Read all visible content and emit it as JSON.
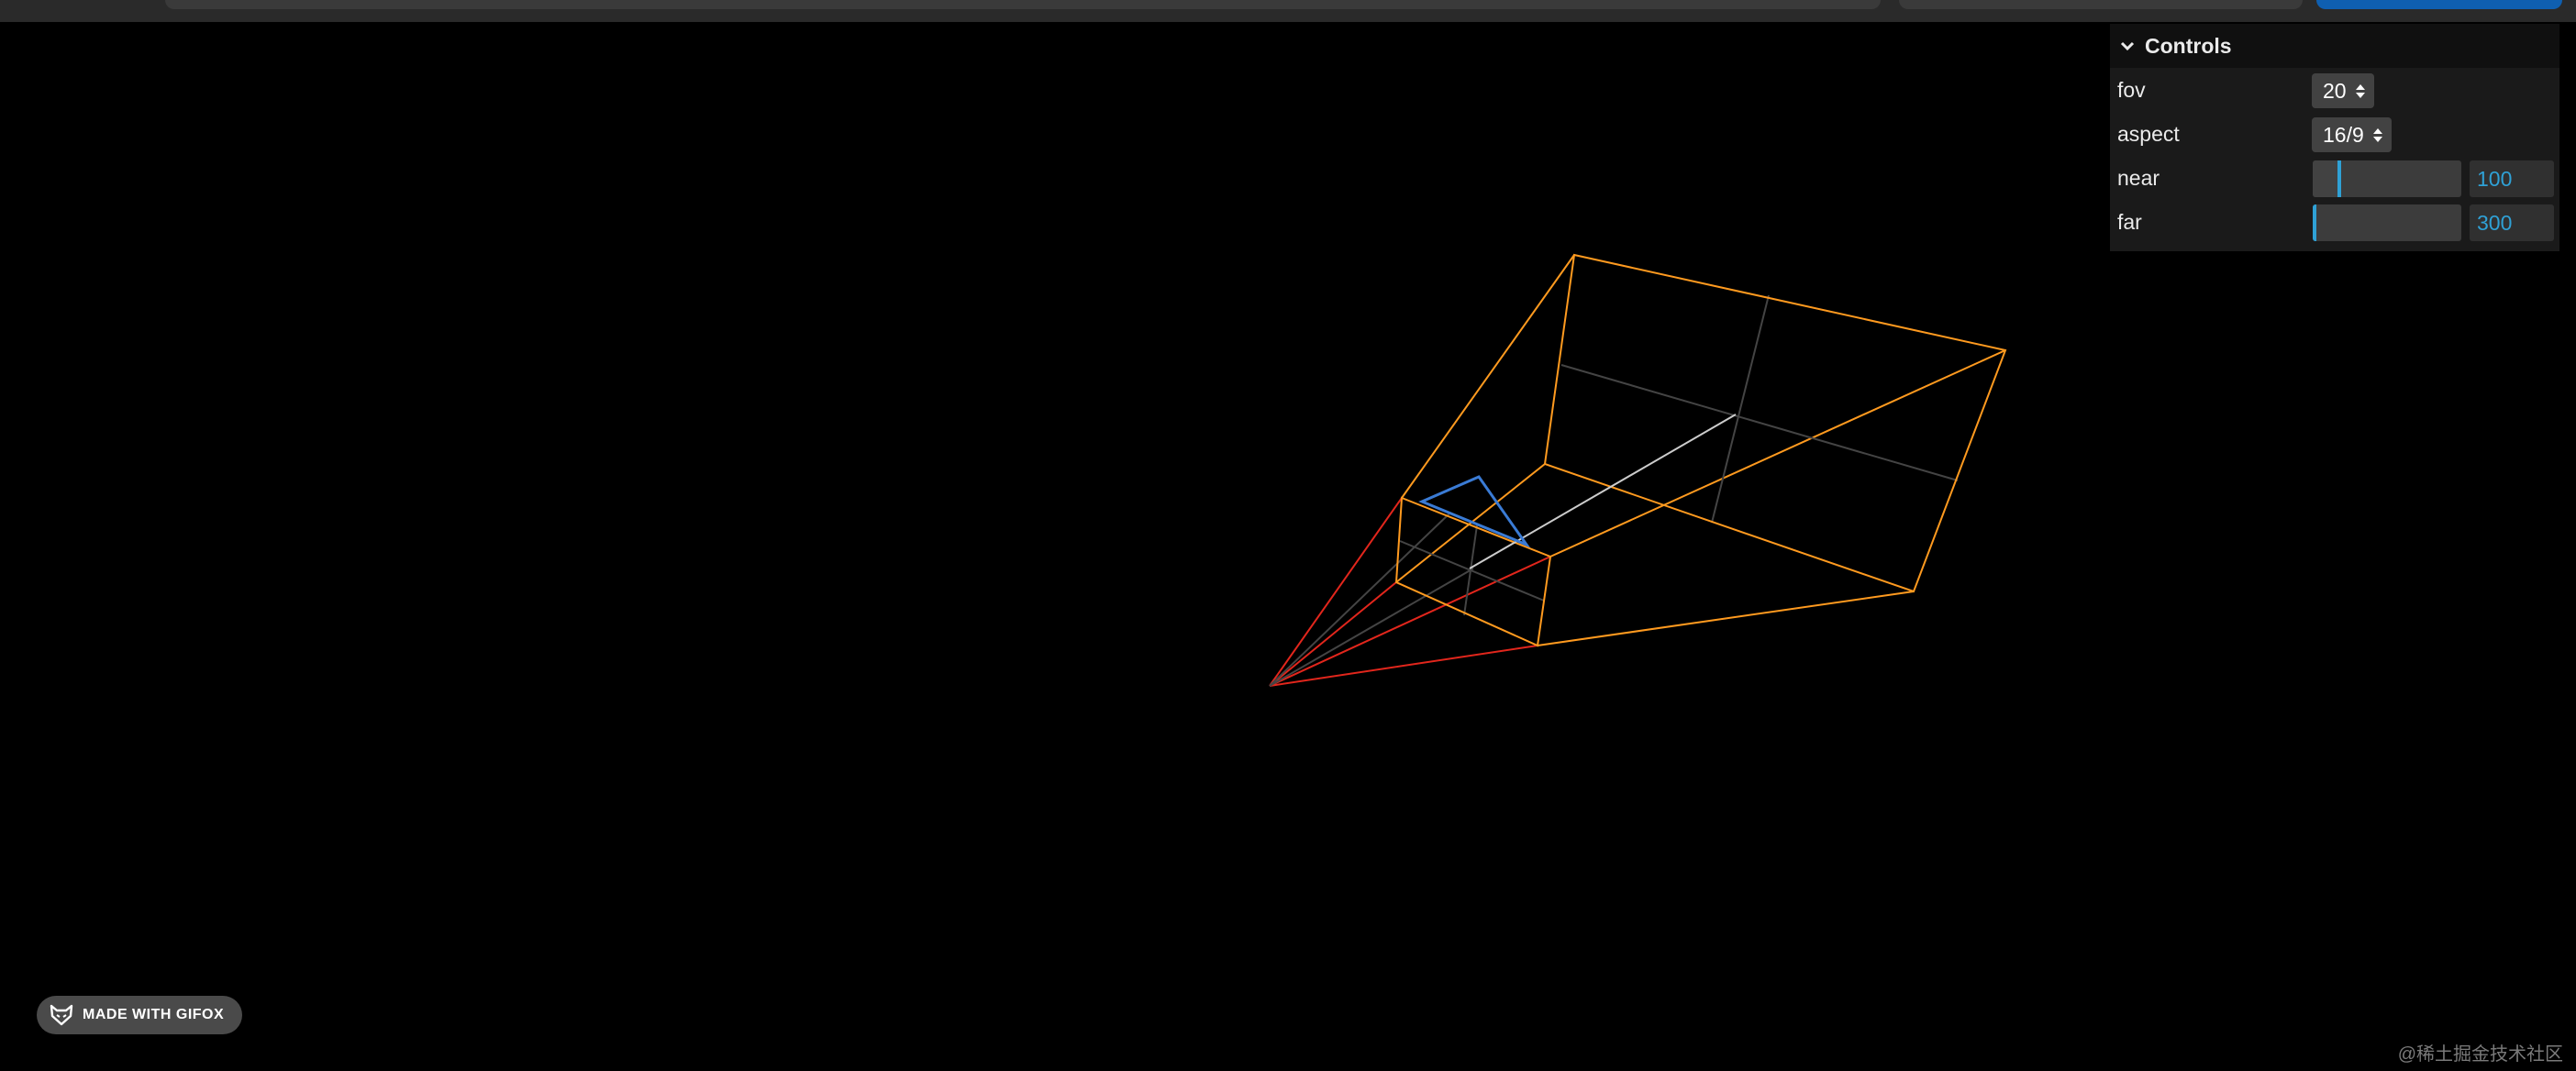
{
  "controls": {
    "title": "Controls",
    "fov": {
      "label": "fov",
      "value": "20"
    },
    "aspect": {
      "label": "aspect",
      "value": "16/9"
    },
    "near": {
      "label": "near",
      "value": "100",
      "slider_fraction": 0.18
    },
    "far": {
      "label": "far",
      "value": "300",
      "slider_fraction": 0.0
    }
  },
  "badge": {
    "text": "MADE WITH GIFOX"
  },
  "watermark": {
    "text": "@稀土掘金技术社区"
  },
  "colors": {
    "background": "#000000",
    "frustum": "#ff9a1f",
    "cone": "#e2261c",
    "up_triangle": "#3a7bd5",
    "target_line": "#cccccc",
    "cross": "#444444",
    "accent": "#2fa1d6"
  }
}
